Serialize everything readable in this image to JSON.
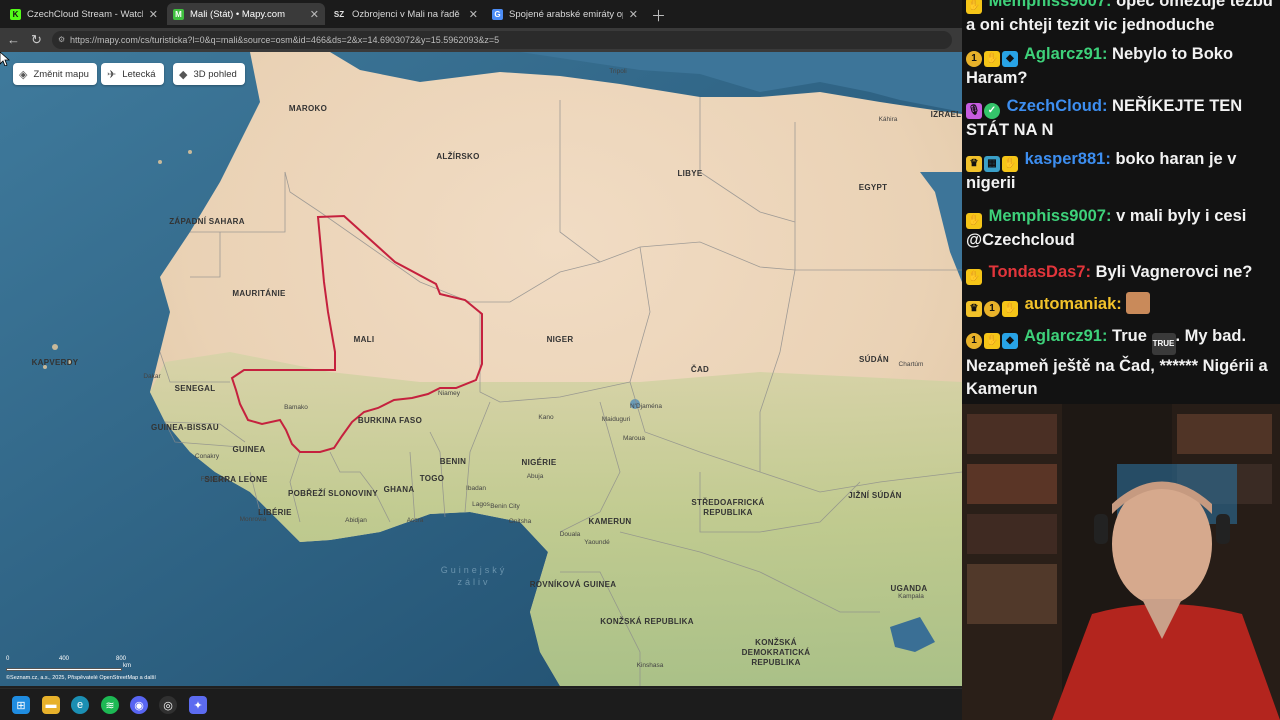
{
  "browser": {
    "tabs": [
      {
        "label": "CzechCloud Stream - Watch Live o",
        "favicon": "K",
        "favicon_color": "#53fc18"
      },
      {
        "label": "Mali (Stát) • Mapy.com",
        "favicon": "M",
        "favicon_color": "#3fbf3f"
      },
      {
        "label": "Ozbrojenci v Mali na řadě míst na",
        "favicon": "SZ",
        "favicon_color": "#e0e0e0"
      },
      {
        "label": "Spojené arabské emiráty opustí Ol",
        "favicon": "G",
        "favicon_color": "#4c8df6"
      }
    ],
    "url": "https://mapy.com/cs/turisticka?l=0&q=mali&source=osm&id=466&ds=2&x=14.6903072&y=15.5962093&z=5"
  },
  "map": {
    "controls": {
      "change_map": "Změnit mapu",
      "aerial": "Letecká",
      "view_3d": "3D pohled"
    },
    "countries": {
      "maroko": "MAROKO",
      "alzirsko": "ALŽÍRSKO",
      "libye": "LIBYE",
      "egypt": "EGYPT",
      "izrael": "IZRAEL",
      "zapadni_sahara": "ZÁPADNÍ SAHARA",
      "mauritanie": "MAURITÁNIE",
      "mali": "MALI",
      "niger": "NIGER",
      "cad": "ČAD",
      "sudan": "SÚDÁN",
      "kapverdy": "KAPVERDY",
      "senegal": "SENEGAL",
      "guinea_bissau": "GUINEA-BISSAU",
      "guinea": "GUINEA",
      "sierra_leone": "SIERRA LEONE",
      "liberie": "LIBÉRIE",
      "pobrezi": "POBŘEŽÍ SLONOVINY",
      "burkina": "BURKINA FASO",
      "ghana": "GHANA",
      "togo": "TOGO",
      "benin": "BENIN",
      "nigerie": "NIGÉRIE",
      "kamerun": "KAMERUN",
      "sar": "STŘEDOAFRICKÁ\nREPUBLIKA",
      "jizni_sudan": "JIŽNÍ SÚDÁN",
      "rovnikova": "ROVNÍKOVÁ GUINEA",
      "konzska": "KONŽSKÁ REPUBLIKA",
      "uganda": "UGANDA",
      "kdr": "KONŽSKÁ\nDEMOKRATICKÁ\nREPUBLIKA"
    },
    "cities": {
      "tripoli": "Tripoli",
      "kahira": "Káhira",
      "dakar": "Dakar",
      "bamako": "Bamako",
      "niamey": "Niamey",
      "ndjamena": "N'Djaména",
      "chartum": "Chartúm",
      "conakry": "Conakry",
      "freetown": "Freetown",
      "monrovia": "Monrovia",
      "abidjan": "Abidjan",
      "accra": "Accra",
      "lagos": "Lagos",
      "abuja": "Abuja",
      "kano": "Kano",
      "maiduguri": "Maiduguri",
      "maroua": "Maroua",
      "ibadan": "Ibadan",
      "yaounde": "Yaoundé",
      "kampala": "Kampala",
      "kinshasa": "Kinshasa",
      "benin_city": "Benin City",
      "onitsha": "Onitsha",
      "douala": "Douala"
    },
    "sea_label": "Guinejský\nzáliv",
    "scale": {
      "zero": "0",
      "mid": "400",
      "max": "800",
      "unit": "km"
    },
    "attribution": "©Seznam.cz, a.s., 2025, Přispěvatelé OpenStreetMap a další"
  },
  "chat": [
    {
      "badges": [
        "hand"
      ],
      "user": "Memphiss9007",
      "user_color": "#3ed17a",
      "text": "opec omezuje tezbu a oni chteji tezit vic jednoduche"
    },
    {
      "badges": [
        "gold",
        "hand",
        "cube"
      ],
      "user": "Aglarcz91",
      "user_color": "#3ed17a",
      "text": "Nebylo to Boko Haram?"
    },
    {
      "badges": [
        "mic",
        "check"
      ],
      "user": "CzechCloud",
      "user_color": "#3d8ef0",
      "text": "NEŘÍKEJTE TEN STÁT NA N"
    },
    {
      "badges": [
        "crown",
        "grid",
        "hand"
      ],
      "user": "kasper881",
      "user_color": "#3d8ef0",
      "text": "boko haran je v nigerii"
    },
    {
      "badges": [
        "hand"
      ],
      "user": "Memphiss9007",
      "user_color": "#3ed17a",
      "text": "v mali byly i cesi @Czechcloud"
    },
    {
      "badges": [
        "hand"
      ],
      "user": "TondasDas7",
      "user_color": "#e2353b",
      "text": "Byli Vagnerovci ne?"
    },
    {
      "badges": [
        "crown",
        "gold",
        "hand"
      ],
      "user": "automaniak",
      "user_color": "#f2c22a",
      "text": ""
    },
    {
      "badges": [
        "gold",
        "hand",
        "cube"
      ],
      "user": "Aglarcz91",
      "user_color": "#3ed17a",
      "text_before": "True",
      "emote": "TRUE",
      "text": ". My bad. Nezapmeň ještě na Čad, ****** Nigérii a Kamerun"
    }
  ],
  "taskbar": [
    "windows-start",
    "file-explorer",
    "edge",
    "spotify",
    "discord",
    "obs",
    "app"
  ]
}
